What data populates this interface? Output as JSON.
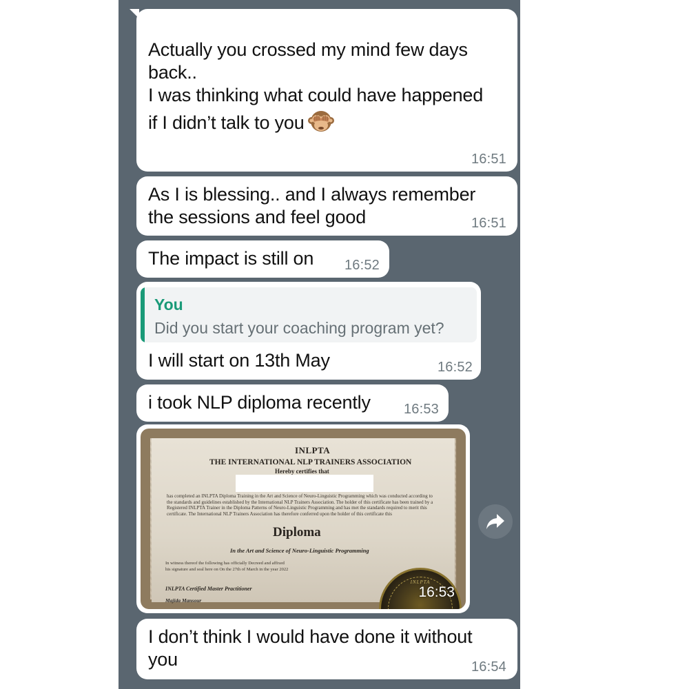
{
  "chat": {
    "messages": [
      {
        "text": "Actually you crossed my mind few days\nback..\nI was thinking what could have happened\nif I didn’t talk to you",
        "emoji": "see-no-evil-monkey-icon",
        "time": "16:51"
      },
      {
        "text": "As I is blessing.. and I always remember\nthe sessions and feel good",
        "time": "16:51"
      },
      {
        "text": "The impact is still on",
        "time": "16:52"
      },
      {
        "reply_to": {
          "author": "You",
          "text": "Did you start your coaching program yet?"
        },
        "text": "I will start on 13th May",
        "time": "16:52"
      },
      {
        "text": "i took NLP diploma recently",
        "time": "16:53"
      },
      {
        "image": {
          "title": "INLPTA",
          "organization": "THE INTERNATIONAL NLP TRAINERS ASSOCIATION",
          "certifies": "Hereby certifies that",
          "body": "has completed an INLPTA Diploma Training in the Art and Science of Neuro-Linguistic Programming which was conducted according to the standards and guidelines established by the International NLP Trainers Association. The holder of this certificate has been trained by a Registered INLPTA Trainer in the Diploma Patterns of Neuro-Linguistic Programming and has met the standards required to merit this certificate. The International NLP Trainers Association has therefore conferred upon the holder of this certificate this",
          "diploma": "Diploma",
          "art_science": "In the Art and Science of Neuro-Linguistic Programming",
          "witness": "In witness thereof the following has officially Decreed and affixed his signature and seal here on On the 27th of March in the year 2022",
          "certified_master": "INLPTA Certified Master Practitioner",
          "signature_name": "Majida Mansour",
          "seal_text": "INLPTA"
        },
        "time": "16:53"
      },
      {
        "text": "I don’t think I would have done it without\nyou",
        "time": "16:54"
      }
    ],
    "forward_icon": "forward-arrow-icon"
  },
  "colors": {
    "chat_background": "#5a6670",
    "bubble": "#ffffff",
    "quote_accent": "#1a9a78",
    "timestamp": "#6f7a80"
  }
}
